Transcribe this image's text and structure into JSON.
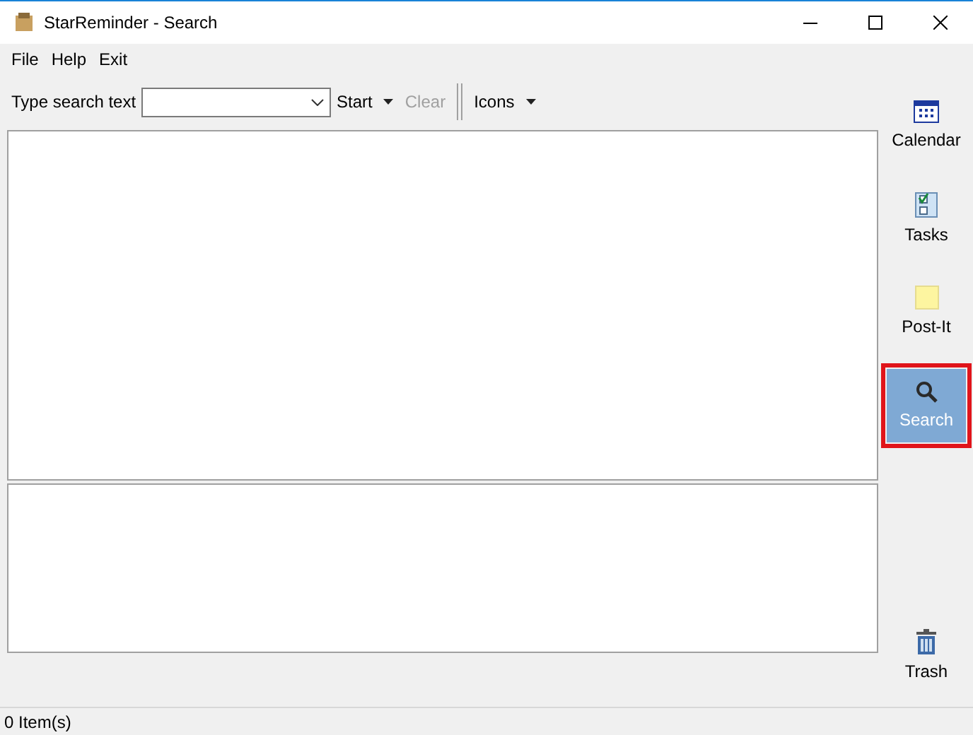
{
  "window": {
    "title": "StarReminder - Search"
  },
  "menu": [
    "File",
    "Help",
    "Exit"
  ],
  "toolbar": {
    "search_label": "Type search text",
    "buttons": [
      {
        "label": "Start",
        "dropdown": true,
        "disabled": false
      },
      {
        "label": "Clear",
        "dropdown": false,
        "disabled": true
      },
      {
        "label": "Icons",
        "dropdown": true,
        "disabled": false
      }
    ]
  },
  "sidebar": {
    "items": [
      {
        "kind": "calendar",
        "label": "Calendar",
        "selected": false
      },
      {
        "kind": "tasks",
        "label": "Tasks",
        "selected": false
      },
      {
        "kind": "postit",
        "label": "Post-It",
        "selected": false
      },
      {
        "kind": "search",
        "label": "Search",
        "selected": true,
        "highlighted": true
      },
      {
        "kind": "trash",
        "label": "Trash",
        "selected": false
      }
    ]
  },
  "status_bar": "0 Item(s)"
}
